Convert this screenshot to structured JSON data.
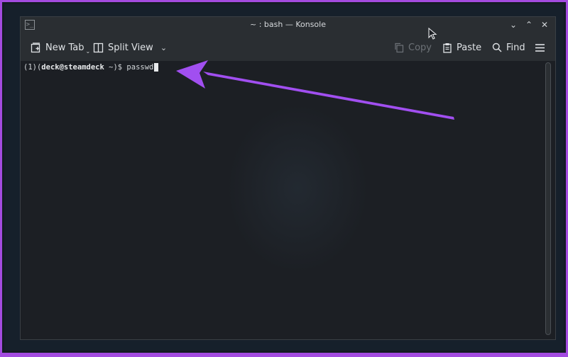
{
  "window": {
    "title": "~ : bash — Konsole",
    "app_icon_glyph": ">_",
    "controls": {
      "minimize": "⌄",
      "maximize": "⌃",
      "close": "✕"
    }
  },
  "toolbar": {
    "new_tab_label": "New Tab",
    "split_view_label": "Split View",
    "copy_label": "Copy",
    "paste_label": "Paste",
    "find_label": "Find"
  },
  "terminal": {
    "prompt_prefix": "(1)(",
    "prompt_user_host": "deck@steamdeck",
    "prompt_suffix": " ~)$ ",
    "command": "passwd"
  },
  "colors": {
    "accent_arrow": "#a14ff0",
    "border_frame": "#a34be0"
  }
}
